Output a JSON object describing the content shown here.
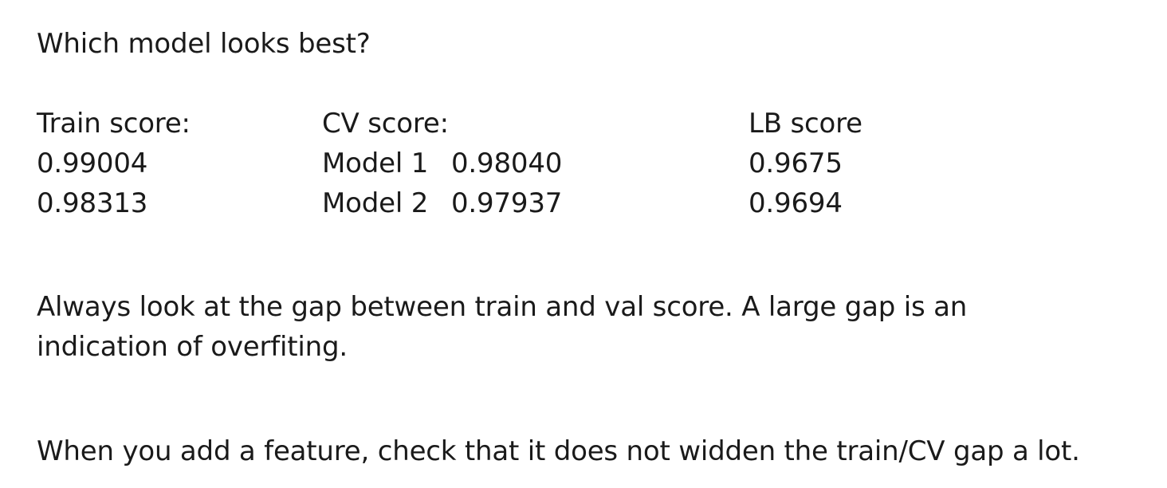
{
  "question": "Which model looks best?",
  "train": {
    "header": "Train score:",
    "values": [
      "0.99004",
      "0.98313"
    ]
  },
  "cv": {
    "header": "CV score:",
    "rows": [
      {
        "model": "Model 1",
        "score": "0.98040"
      },
      {
        "model": "Model 2",
        "score": "0.97937"
      }
    ]
  },
  "lb": {
    "header": "LB score",
    "values": [
      "0.9675",
      "0.9694"
    ]
  },
  "insight": {
    "line1": "Always look at the gap between train and val score.  A large gap is an",
    "line2": "indication of overfiting."
  },
  "tip": "When you add a feature, check that it does not widden the train/CV gap a lot."
}
